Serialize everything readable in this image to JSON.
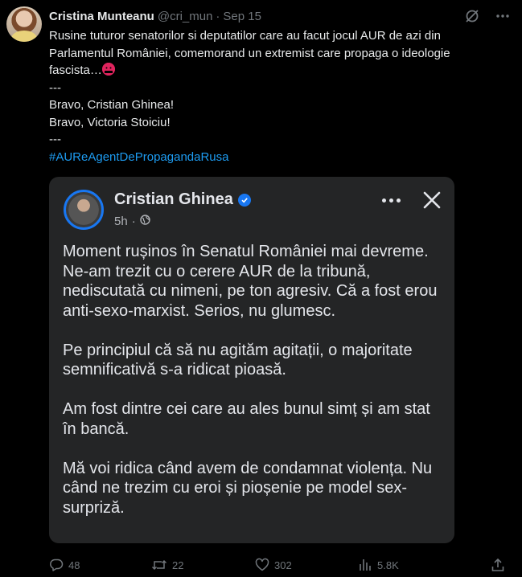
{
  "tweet": {
    "author_name": "Cristina Munteanu",
    "handle": "@cri_mun",
    "separator": "·",
    "date": "Sep 15",
    "lines": [
      "Rusine tuturor senatorilor si deputatilor care au facut jocul AUR de azi din",
      "Parlamentul României, comemorand un extremist care propaga o ideologie",
      "fascista…",
      "---",
      "Bravo, Cristian Ghinea!",
      "Bravo, Victoria Stoiciu!",
      "---"
    ],
    "hashtag": "#AUReAgentDePropagandaRusa"
  },
  "embed": {
    "author_name": "Cristian Ghinea",
    "time": "5h",
    "dot": "·",
    "paragraphs": [
      "Moment rușinos în Senatul României mai devreme. Ne-am trezit cu o cerere AUR de la tribună, nediscutată cu nimeni, pe ton agresiv. Că a fost erou anti-sexo-marxist. Serios, nu glumesc.",
      "Pe principiul că să nu agităm agitații, o majoritate semnificativă s-a ridicat pioasă.",
      "Am fost dintre cei care au ales bunul simț și am stat în bancă.",
      "Mă voi ridica când avem de condamnat violența. Nu când ne trezim cu eroi și pioșenie pe model sex-surpriză."
    ]
  },
  "actions": {
    "replies": "48",
    "reposts": "22",
    "likes": "302",
    "views": "5.8K"
  },
  "icons": {
    "grok": "grok-icon",
    "more": "more-icon",
    "reply": "reply-icon",
    "repost": "repost-icon",
    "like": "heart-icon",
    "views": "views-icon",
    "share": "share-icon"
  },
  "colors": {
    "background": "#000000",
    "text": "#e7e9ea",
    "muted": "#71767b",
    "link": "#1d9bf0",
    "card": "#242526",
    "facebook_blue": "#1877f2"
  }
}
